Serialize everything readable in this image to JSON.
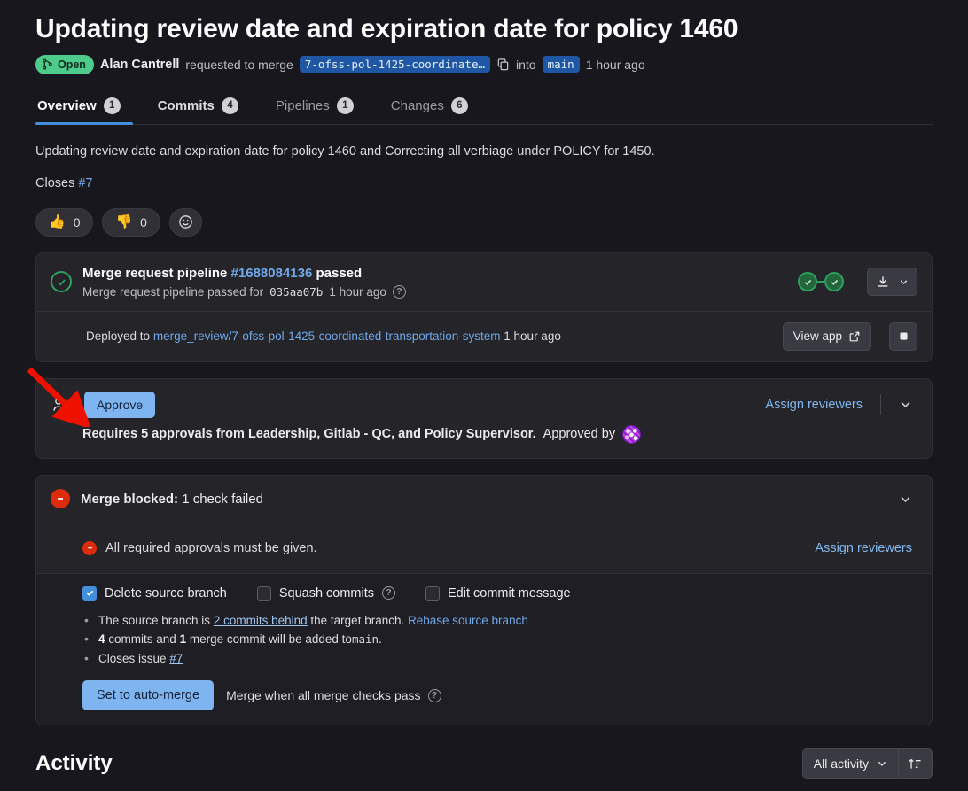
{
  "header": {
    "title": "Updating review date and expiration date for policy 1460",
    "status_badge": "Open",
    "author": "Alan Cantrell",
    "action_text": "requested to merge",
    "source_branch": "7-ofss-pol-1425-coordinate…",
    "into_text": "into",
    "target_branch": "main",
    "timestamp": "1 hour ago"
  },
  "tabs": [
    {
      "label": "Overview",
      "count": "1"
    },
    {
      "label": "Commits",
      "count": "4"
    },
    {
      "label": "Pipelines",
      "count": "1"
    },
    {
      "label": "Changes",
      "count": "6"
    }
  ],
  "description": {
    "body": "Updating review date and expiration date for policy 1460 and Correcting all verbiage under POLICY for 1450.",
    "closes_label": "Closes",
    "closes_ref": "#7"
  },
  "reactions": [
    {
      "emoji": "👍",
      "count": "0",
      "name": "thumbs-up"
    },
    {
      "emoji": "👎",
      "count": "0",
      "name": "thumbs-down"
    }
  ],
  "pipeline": {
    "title_prefix": "Merge request pipeline",
    "id": "#1688084136",
    "title_suffix": "passed",
    "sub_prefix": "Merge request pipeline passed for",
    "commit_sha": "035aa07b",
    "sub_time": "1 hour ago",
    "help": "?",
    "download_label": "",
    "deploy": {
      "prefix": "Deployed to",
      "environment": "merge_review/7-ofss-pol-1425-coordinated-transportation-system",
      "time": "1 hour ago",
      "view_app_label": "View app"
    }
  },
  "approvals": {
    "approve_button": "Approve",
    "note_bold": "Requires 5 approvals from Leadership, Gitlab - QC, and Policy Supervisor.",
    "note_rest": "Approved by",
    "assign_reviewers": "Assign reviewers"
  },
  "merge": {
    "blocked_bold": "Merge blocked:",
    "blocked_rest": "1 check failed",
    "failed_check": "All required approvals must be given.",
    "assign_reviewers": "Assign reviewers",
    "options": [
      {
        "label": "Delete source branch",
        "checked": true,
        "help": false
      },
      {
        "label": "Squash commits",
        "checked": false,
        "help": true
      },
      {
        "label": "Edit commit message",
        "checked": false,
        "help": false
      }
    ],
    "bullets": {
      "b1_pre": "The source branch is",
      "b1_link": "2 commits behind",
      "b1_mid": "the target branch.",
      "b1_action": "Rebase source branch",
      "b2_count": "4",
      "b2_mid": "commits and",
      "b2_merge_count": "1",
      "b2_post": "merge commit will be added to",
      "b2_branch": "main",
      "b2_end": ".",
      "b3_pre": "Closes issue",
      "b3_link": "#7"
    },
    "auto_merge_button": "Set to auto-merge",
    "auto_merge_note": "Merge when all merge checks pass",
    "help": "?"
  },
  "activity": {
    "title": "Activity",
    "filter_label": "All activity",
    "sort_icon": "sort-order-icon"
  },
  "colors": {
    "accent_blue": "#428fdc",
    "primary_button": "#7eb5f0",
    "success_green": "#2da160",
    "danger_red": "#dd2b0e",
    "open_badge_green": "#4ccb8b",
    "annotation_red": "#ee1100"
  }
}
